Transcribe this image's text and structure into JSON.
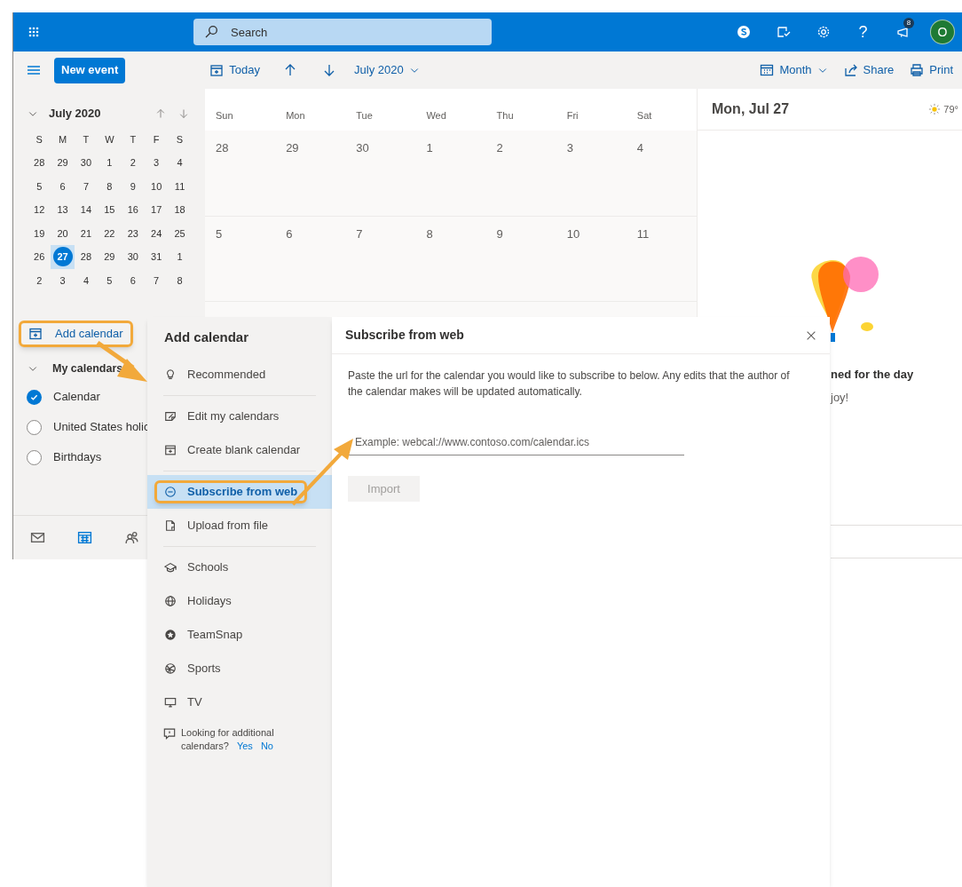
{
  "top_bar": {
    "search_placeholder": "Search",
    "help_glyph": "?",
    "notification_count": "8",
    "avatar_initial": "O"
  },
  "toolbar": {
    "new_event": "New event",
    "today": "Today",
    "period": "July 2020",
    "view": "Month",
    "share": "Share",
    "print": "Print"
  },
  "mini_calendar": {
    "title": "July 2020",
    "weekdays": [
      "S",
      "M",
      "T",
      "W",
      "T",
      "F",
      "S"
    ],
    "weeks": [
      [
        {
          "day": "28",
          "selected": false
        },
        {
          "day": "29",
          "selected": false
        },
        {
          "day": "30",
          "selected": false
        },
        {
          "day": "1",
          "selected": false
        },
        {
          "day": "2",
          "selected": false
        },
        {
          "day": "3",
          "selected": false
        },
        {
          "day": "4",
          "selected": false
        }
      ],
      [
        {
          "day": "5",
          "selected": false
        },
        {
          "day": "6",
          "selected": false
        },
        {
          "day": "7",
          "selected": false
        },
        {
          "day": "8",
          "selected": false
        },
        {
          "day": "9",
          "selected": false
        },
        {
          "day": "10",
          "selected": false
        },
        {
          "day": "11",
          "selected": false
        }
      ],
      [
        {
          "day": "12",
          "selected": false
        },
        {
          "day": "13",
          "selected": false
        },
        {
          "day": "14",
          "selected": false
        },
        {
          "day": "15",
          "selected": false
        },
        {
          "day": "16",
          "selected": false
        },
        {
          "day": "17",
          "selected": false
        },
        {
          "day": "18",
          "selected": false
        }
      ],
      [
        {
          "day": "19",
          "selected": false
        },
        {
          "day": "20",
          "selected": false
        },
        {
          "day": "21",
          "selected": false
        },
        {
          "day": "22",
          "selected": false
        },
        {
          "day": "23",
          "selected": false
        },
        {
          "day": "24",
          "selected": false
        },
        {
          "day": "25",
          "selected": false
        }
      ],
      [
        {
          "day": "26",
          "selected": false
        },
        {
          "day": "27",
          "selected": true
        },
        {
          "day": "28",
          "selected": false
        },
        {
          "day": "29",
          "selected": false
        },
        {
          "day": "30",
          "selected": false
        },
        {
          "day": "31",
          "selected": false
        },
        {
          "day": "1",
          "selected": false
        }
      ],
      [
        {
          "day": "2",
          "selected": false
        },
        {
          "day": "3",
          "selected": false
        },
        {
          "day": "4",
          "selected": false
        },
        {
          "day": "5",
          "selected": false
        },
        {
          "day": "6",
          "selected": false
        },
        {
          "day": "7",
          "selected": false
        },
        {
          "day": "8",
          "selected": false
        }
      ]
    ]
  },
  "add_calendar_link": {
    "label": "Add calendar",
    "highlighted": true
  },
  "my_calendars": {
    "title": "My calendars",
    "items": [
      {
        "label": "Calendar",
        "checked": true
      },
      {
        "label": "United States holic",
        "checked": false
      },
      {
        "label": "Birthdays",
        "checked": false
      }
    ]
  },
  "bottom_nav": [
    {
      "kind": "mail",
      "selected": false
    },
    {
      "kind": "calendar",
      "selected": true
    },
    {
      "kind": "people",
      "selected": false
    }
  ],
  "month_grid": {
    "weekdays": [
      "Sun",
      "Mon",
      "Tue",
      "Wed",
      "Thu",
      "Fri",
      "Sat"
    ],
    "weeks": [
      [
        "28",
        "29",
        "30",
        "1",
        "2",
        "3",
        "4"
      ],
      [
        "5",
        "6",
        "7",
        "8",
        "9",
        "10",
        "11"
      ]
    ]
  },
  "day_pane": {
    "title": "Mon, Jul 27",
    "temperature": "79°",
    "message_title": "ned for the day",
    "message_body": "joy!"
  },
  "add_calendar_panel": {
    "title": "Add calendar",
    "groups": [
      [
        {
          "label": "Recommended",
          "kind": "bulb",
          "selected": false,
          "highlighted": false
        }
      ],
      [
        {
          "label": "Edit my calendars",
          "kind": "edit",
          "selected": false,
          "highlighted": false
        },
        {
          "label": "Create blank calendar",
          "kind": "calendar-plus",
          "selected": false,
          "highlighted": false
        }
      ],
      [
        {
          "label": "Subscribe from web",
          "kind": "web",
          "selected": true,
          "highlighted": true
        },
        {
          "label": "Upload from file",
          "kind": "file",
          "selected": false,
          "highlighted": false
        }
      ],
      [
        {
          "label": "Schools",
          "kind": "school",
          "selected": false,
          "highlighted": false
        },
        {
          "label": "Holidays",
          "kind": "globe",
          "selected": false,
          "highlighted": false
        },
        {
          "label": "TeamSnap",
          "kind": "star",
          "selected": false,
          "highlighted": false
        },
        {
          "label": "Sports",
          "kind": "ball",
          "selected": false,
          "highlighted": false
        },
        {
          "label": "TV",
          "kind": "tv",
          "selected": false,
          "highlighted": false
        }
      ]
    ],
    "feedback": {
      "question": "Looking for additional calendars?",
      "yes": "Yes",
      "no": "No"
    }
  },
  "dialog": {
    "title": "Subscribe from web",
    "description": "Paste the url for the calendar you would like to subscribe to below. Any edits that the author of the calendar makes will be updated automatically.",
    "url_placeholder": "Example: webcal://www.contoso.com/calendar.ics",
    "import_button": {
      "label": "Import",
      "disabled": true
    }
  }
}
